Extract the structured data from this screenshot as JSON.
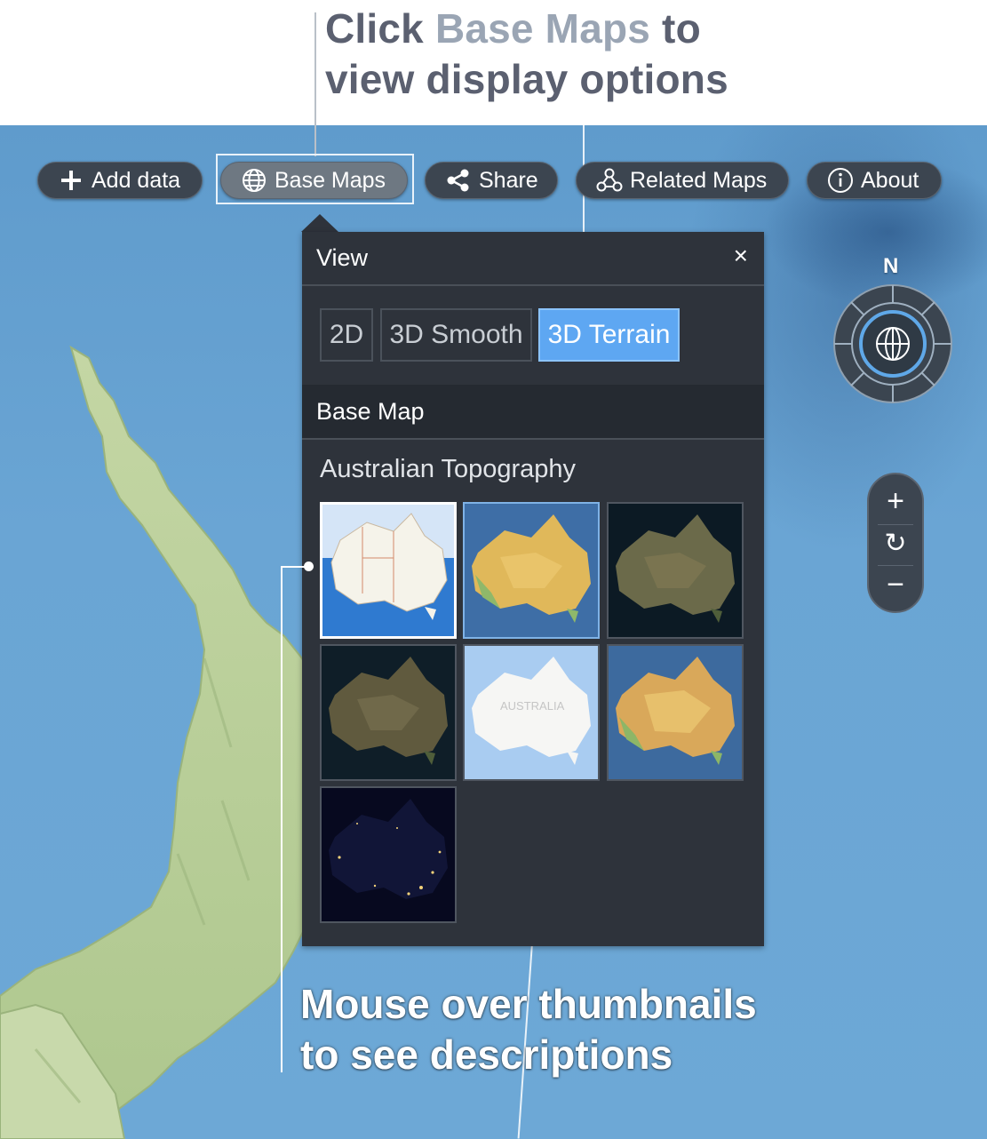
{
  "captions": {
    "top_prefix": "Click ",
    "top_highlight": "Base Maps",
    "top_suffix": " to",
    "top_line2": "view display options",
    "bottom_line1": "Mouse over thumbnails",
    "bottom_line2": "to see descriptions"
  },
  "toolbar": {
    "add_data": "Add data",
    "base_maps": "Base Maps",
    "share": "Share",
    "related_maps": "Related Maps",
    "about": "About"
  },
  "panel": {
    "view_title": "View",
    "close": "×",
    "view_modes": [
      "2D",
      "3D Smooth",
      "3D Terrain"
    ],
    "selected_view_mode": "3D Terrain",
    "base_map_title": "Base Map",
    "group_label": "Australian Topography",
    "thumbnails": [
      {
        "icon": "topographic-map-thumbnail",
        "selected": true
      },
      {
        "icon": "terrain-relief-thumbnail",
        "selected": false
      },
      {
        "icon": "satellite-imagery-thumbnail",
        "selected": false
      },
      {
        "icon": "satellite-dark-thumbnail",
        "selected": false
      },
      {
        "icon": "street-map-thumbnail",
        "selected": false,
        "text": "AUSTRALIA"
      },
      {
        "icon": "terrain-colour-thumbnail",
        "selected": false
      },
      {
        "icon": "night-lights-thumbnail",
        "selected": false
      }
    ]
  },
  "navigation": {
    "compass_north": "N",
    "zoom_in": "+",
    "reset": "↻",
    "zoom_out": "−"
  },
  "colors": {
    "toolbar_bg": "#3c4550",
    "panel_bg": "#2e333b",
    "accent": "#5ea7f2",
    "ocean": "#6aa5d4",
    "land": "#b9cf9a"
  }
}
